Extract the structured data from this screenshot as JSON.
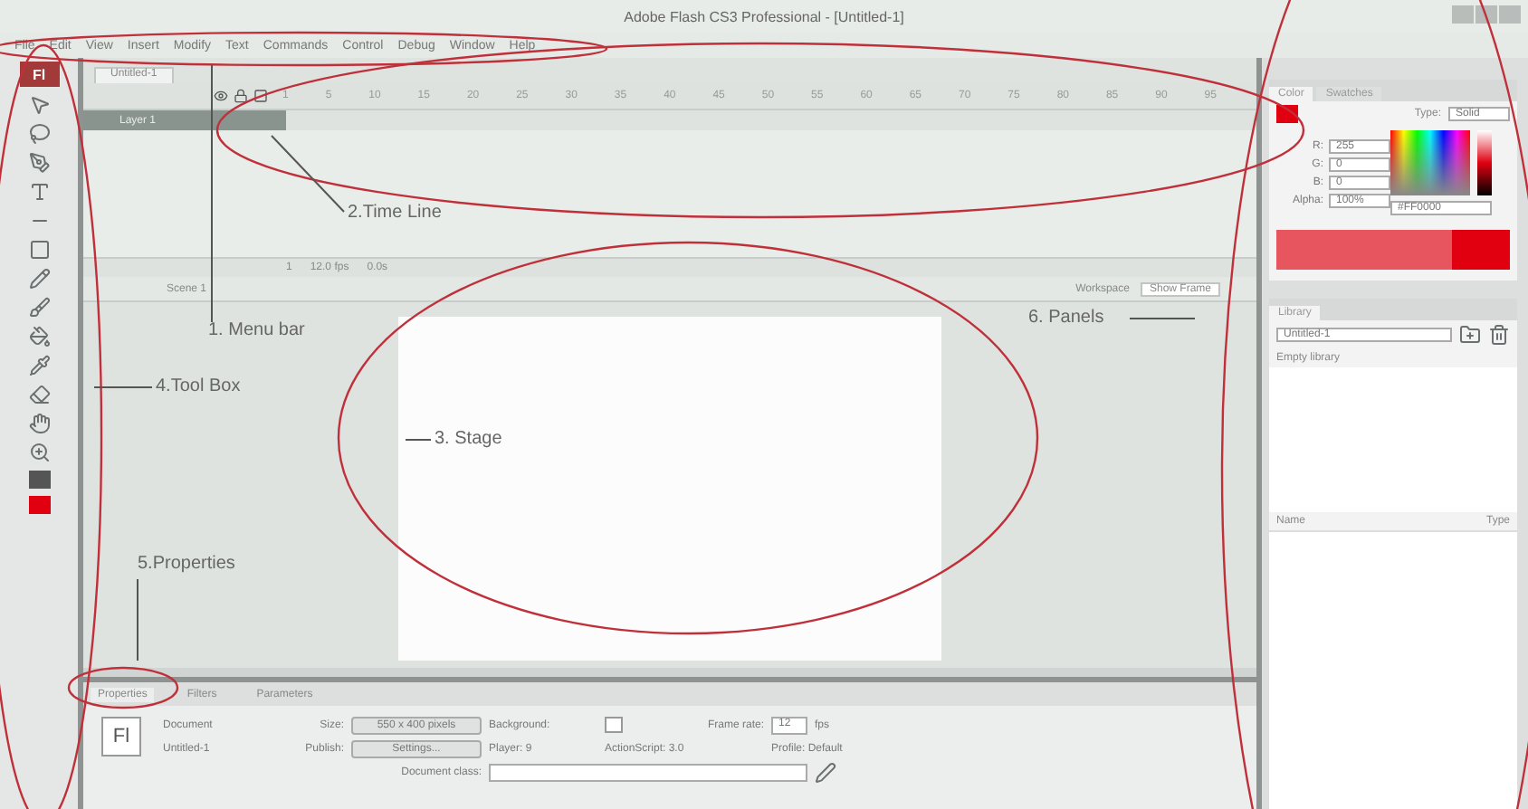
{
  "window": {
    "title": "Adobe Flash CS3 Professional - [Untitled-1]"
  },
  "menu": [
    "File",
    "Edit",
    "View",
    "Insert",
    "Modify",
    "Text",
    "Commands",
    "Control",
    "Debug",
    "Window",
    "Help"
  ],
  "app_badge": "Fl",
  "document_tab": {
    "label": "Untitled-1",
    "selected": true
  },
  "timeline": {
    "layer": "Layer 1",
    "frames": [
      "1",
      "5",
      "10",
      "15",
      "20",
      "25",
      "30",
      "35",
      "40",
      "45",
      "50",
      "55",
      "60",
      "65",
      "70",
      "75",
      "80",
      "85",
      "90",
      "95"
    ],
    "status": [
      "1",
      "12.0 fps",
      "0.0s"
    ]
  },
  "edit_bar": {
    "scene": "Scene 1",
    "workspace": "Workspace",
    "zoom": "Show Frame"
  },
  "color_panel": {
    "tabs": [
      {
        "label": "Color",
        "selected": true
      },
      {
        "label": "Swatches",
        "selected": false
      }
    ],
    "type_label": "Type:",
    "type": "Solid",
    "channels": [
      {
        "label": "R:",
        "value": "255"
      },
      {
        "label": "G:",
        "value": "0"
      },
      {
        "label": "B:",
        "value": "0"
      },
      {
        "label": "Alpha:",
        "value": "100%"
      }
    ],
    "hex": "#FF0000",
    "color": "#e00010"
  },
  "library_panel": {
    "tab": "Library",
    "document": "Untitled-1",
    "status": "Empty library",
    "columns": [
      "Name",
      "Type"
    ]
  },
  "properties": {
    "tabs": [
      {
        "label": "Properties",
        "selected": true
      },
      {
        "label": "Filters",
        "selected": false
      },
      {
        "label": "Parameters",
        "selected": false
      }
    ],
    "badge": "Fl",
    "kind_label": "Document",
    "doc_name": "Untitled-1",
    "size_label": "Size:",
    "size_button": "550 x 400 pixels",
    "publish_label": "Publish:",
    "publish_button": "Settings...",
    "background_label": "Background:",
    "frame_rate_label": "Frame rate:",
    "frame_rate": "12",
    "fps": "fps",
    "player": "Player: 9",
    "actionscript": "ActionScript: 3.0",
    "profile": "Profile: Default",
    "class_label": "Document class:"
  },
  "annotations": [
    {
      "label": "1. Menu bar"
    },
    {
      "label": "2.Time Line"
    },
    {
      "label": "3. Stage"
    },
    {
      "label": "4.Tool Box"
    },
    {
      "label": "5.Properties"
    },
    {
      "label": "6. Panels"
    }
  ]
}
